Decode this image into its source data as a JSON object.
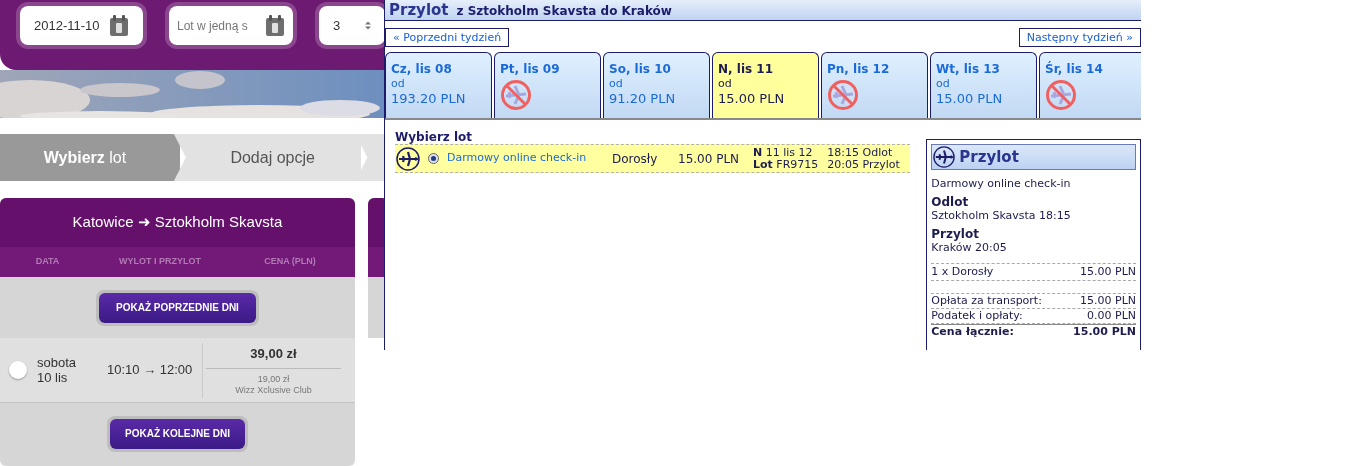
{
  "search_bar": {
    "date": "2012-11-10",
    "trip_type": "Lot w jedną s",
    "passengers": "3"
  },
  "steps": [
    {
      "label": "**Wybierz** lot",
      "selected": true
    },
    {
      "label": "Dodaj opcje",
      "selected": false
    }
  ],
  "outbound_panel": {
    "title": "Katowice ➜ Sztokholm Skavsta",
    "columns": [
      "DATA",
      "WYLOT I PRZYLOT",
      "CENA (PLN)"
    ],
    "previous_button": "POKAŻ POPRZEDNIE DNI",
    "rows": [
      {
        "day": "sobota",
        "date": "10 lis",
        "times": "10:10 → 12:00",
        "price": "39,00 zł",
        "club_price": "19,00 zł",
        "club_name": "Wizz Xclusive Club",
        "selected": false
      }
    ],
    "next_button": "POKAŻ KOLEJNE DNI"
  },
  "arrival": {
    "title": "Przylot",
    "route": "z Sztokholm Skavsta do Kraków",
    "prev_week": "« Poprzedni tydzień",
    "next_week": "Następny tydzień »",
    "days": [
      {
        "label": "Cz, lis 08",
        "from": "od",
        "price": "193.20 PLN",
        "available": true,
        "selected": false
      },
      {
        "label": "Pt, lis 09",
        "available": false,
        "selected": false
      },
      {
        "label": "So, lis 10",
        "from": "od",
        "price": "91.20 PLN",
        "available": true,
        "selected": false
      },
      {
        "label": "N, lis 11",
        "from": "od",
        "price": "15.00 PLN",
        "available": true,
        "selected": true
      },
      {
        "label": "Pn, lis 12",
        "available": false,
        "selected": false
      },
      {
        "label": "Wt, lis 13",
        "from": "od",
        "price": "15.00 PLN",
        "available": true,
        "selected": false
      },
      {
        "label": "Śr, lis 14",
        "available": false,
        "selected": false
      }
    ],
    "section_title": "Wybierz lot",
    "flights": [
      {
        "fare": "Darmowy online check-in",
        "passenger": "Dorosły",
        "price": "15.00 PLN",
        "day_label": "N",
        "date": "11 lis 12",
        "flight_label": "Lot",
        "flight_number": "FR9715",
        "departure": "18:15 Odlot",
        "arrival": "20:05 Przylot",
        "selected": true
      }
    ]
  },
  "summary": {
    "title": "Przylot",
    "fare": "Darmowy online check-in",
    "departure_label": "Odlot",
    "departure": "Sztokholm Skavsta 18:15",
    "arrival_label": "Przylot",
    "arrival": "Kraków 20:05",
    "lines": [
      {
        "label": "1 x Dorosły",
        "amount": "15.00 PLN"
      }
    ],
    "fees": [
      {
        "label": "Opłata za transport:",
        "amount": "15.00 PLN"
      },
      {
        "label": "Podatek i opłaty:",
        "amount": "0.00 PLN"
      }
    ],
    "total": {
      "label": "Cena łącznie:",
      "amount": "15.00 PLN"
    }
  }
}
